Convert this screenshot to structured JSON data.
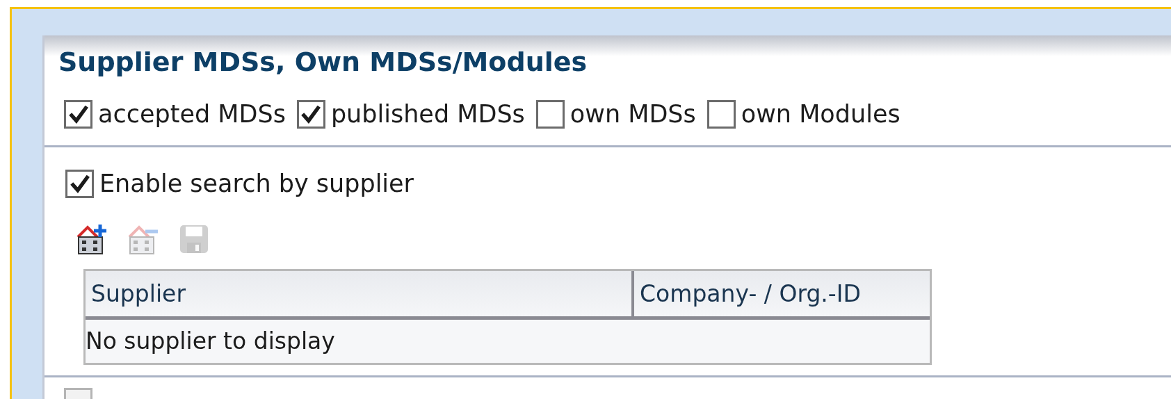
{
  "panel": {
    "title": "Supplier MDSs, Own MDSs/Modules"
  },
  "filters": [
    {
      "label": "accepted MDSs",
      "checked": true
    },
    {
      "label": "published MDSs",
      "checked": true
    },
    {
      "label": "own MDSs",
      "checked": false
    },
    {
      "label": "own Modules",
      "checked": false
    }
  ],
  "supplier_search": {
    "label": "Enable search by supplier",
    "checked": true
  },
  "toolbar": [
    {
      "kind": "add",
      "disabled": false
    },
    {
      "kind": "remove",
      "disabled": true
    },
    {
      "kind": "save",
      "disabled": true
    }
  ],
  "table": {
    "columns": [
      "Supplier",
      "Company- / Org.-ID"
    ],
    "empty_message": "No supplier to display"
  },
  "next_option": {
    "checked": false
  }
}
